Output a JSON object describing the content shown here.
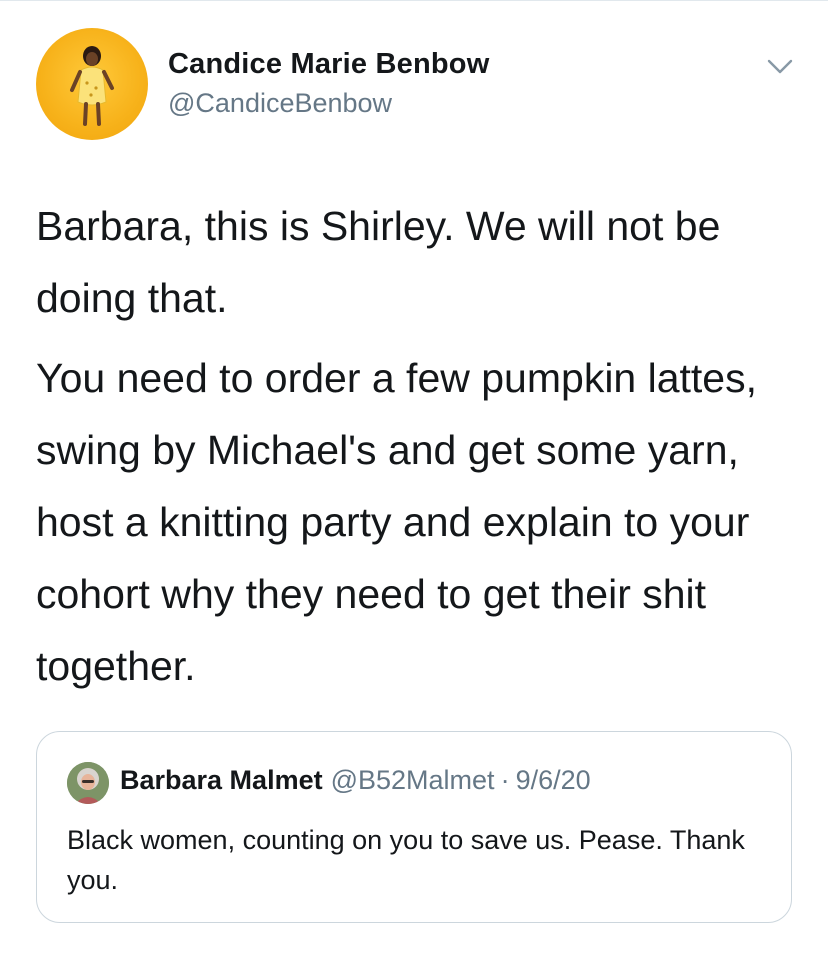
{
  "author": {
    "name": "Candice Marie Benbow",
    "handle": "@CandiceBenbow"
  },
  "tweet": {
    "paragraphs": [
      "Barbara, this is Shirley. We will not be doing that.",
      "You need to order a few pumpkin lattes, swing by Michael's and get some yarn, host a knitting party and explain to your cohort why they need to get their shit together."
    ]
  },
  "quoted_tweet": {
    "name": "Barbara Malmet",
    "handle": "@B52Malmet",
    "separator": "·",
    "date": "9/6/20",
    "text": "Black women, counting on you to save us. Pease. Thank you."
  },
  "icons": {
    "menu": "chevron-down-icon"
  },
  "colors": {
    "text_primary": "#14171a",
    "text_secondary": "#657786",
    "border": "#ccd6dd",
    "avatar_background": "#f7b21a"
  }
}
